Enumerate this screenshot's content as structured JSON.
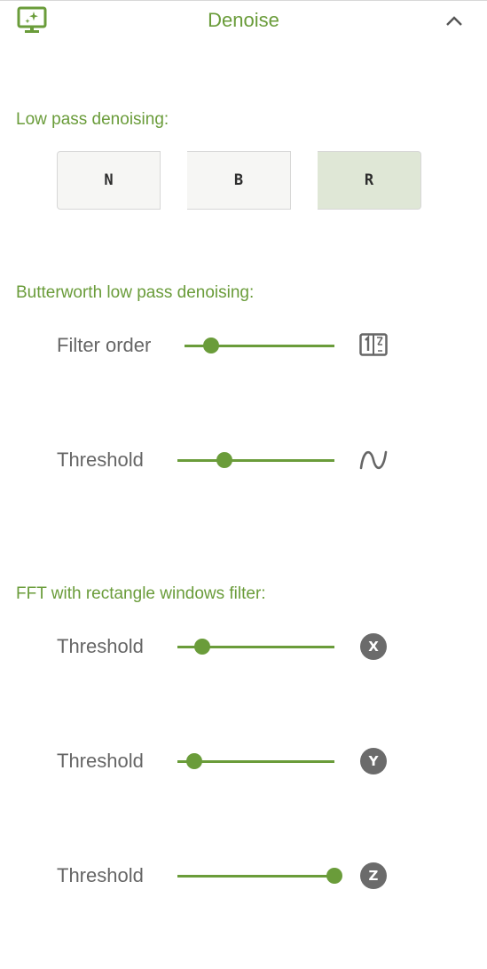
{
  "panel": {
    "title": "Denoise",
    "header_icon": "monitor-sparkle-icon",
    "collapse_icon": "chevron-up-icon"
  },
  "low_pass": {
    "title": "Low pass denoising:",
    "buttons": [
      {
        "label": "N",
        "selected": false
      },
      {
        "label": "B",
        "selected": false
      },
      {
        "label": "R",
        "selected": true
      }
    ]
  },
  "butterworth": {
    "title": "Butterworth low pass denoising:",
    "filter_order": {
      "label": "Filter order",
      "value_fraction": 0.18,
      "icon": "fraction-order-icon"
    },
    "threshold": {
      "label": "Threshold",
      "value_fraction": 0.3,
      "icon": "sine-wave-icon"
    }
  },
  "fft": {
    "title": "FFT with rectangle windows filter:",
    "threshold_x": {
      "label": "Threshold",
      "value_fraction": 0.16,
      "badge": "X"
    },
    "threshold_y": {
      "label": "Threshold",
      "value_fraction": 0.11,
      "badge": "Y"
    },
    "threshold_z": {
      "label": "Threshold",
      "value_fraction": 1.0,
      "badge": "Z"
    }
  },
  "colors": {
    "accent": "#6a9c3a",
    "selected_bg": "#dfe7d6",
    "button_bg": "#f6f6f4",
    "label": "#666666",
    "badge": "#6b6b6b"
  }
}
